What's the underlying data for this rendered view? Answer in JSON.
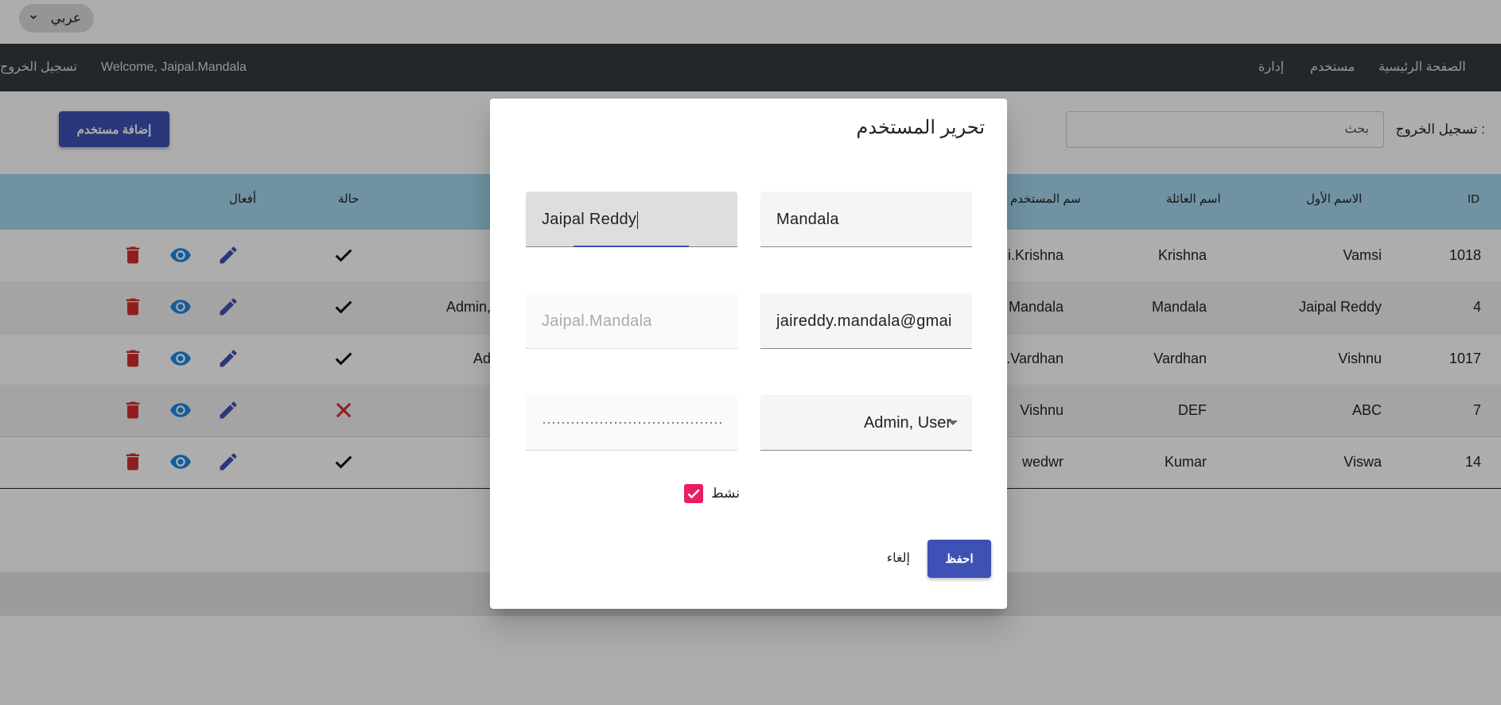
{
  "language_select": {
    "value": "عربي"
  },
  "navbar": {
    "welcome": "Welcome, Jaipal.Mandala",
    "logout": "تسجيل الخروج",
    "home": "الصفحة الرئيسية",
    "user": "مستخدم",
    "admin": "إدارة"
  },
  "toolbar": {
    "add_user": "إضافة مستخدم",
    "search_label": "تسجيل الخروج :",
    "search_placeholder": "بحث"
  },
  "table": {
    "headers": {
      "id": "ID",
      "first_name": "الاسم الأول",
      "family_name": "اسم العائلة",
      "username": "سم المستخدم",
      "status": "حالة",
      "actions": "أفعال"
    },
    "rows": [
      {
        "id": "1018",
        "first_name": "Vamsi",
        "family_name": "Krishna",
        "username": "i.Krishna",
        "roles": "",
        "active": true
      },
      {
        "id": "4",
        "first_name": "Jaipal Reddy",
        "family_name": "Mandala",
        "username": "Mandala",
        "roles": "Admin,",
        "active": true
      },
      {
        "id": "1017",
        "first_name": "Vishnu",
        "family_name": "Vardhan",
        "username": ".Vardhan",
        "roles": "Ad",
        "active": true
      },
      {
        "id": "7",
        "first_name": "ABC",
        "family_name": "DEF",
        "username": "Vishnu",
        "roles": "",
        "active": false
      },
      {
        "id": "14",
        "first_name": "Viswa",
        "family_name": "Kumar",
        "username": "wedwr",
        "roles": "",
        "active": true
      }
    ]
  },
  "dialog": {
    "title": "تحرير المستخدم",
    "first_name": "Jaipal Reddy",
    "family_name": "Mandala",
    "username": "Jaipal.Mandala",
    "email": "jaireddy.mandala@gmai",
    "roles": "Admin, User",
    "active_label": "نشط",
    "active": true,
    "save": "احفظ",
    "cancel": "إلغاء"
  },
  "colors": {
    "primary": "#3f51b5",
    "accent": "#e91e63",
    "navbar": "#343a40",
    "table_header": "#a6d8f0",
    "delete_icon": "#d32f2f",
    "view_icon": "#1e88e5",
    "edit_icon": "#3f51b5"
  }
}
